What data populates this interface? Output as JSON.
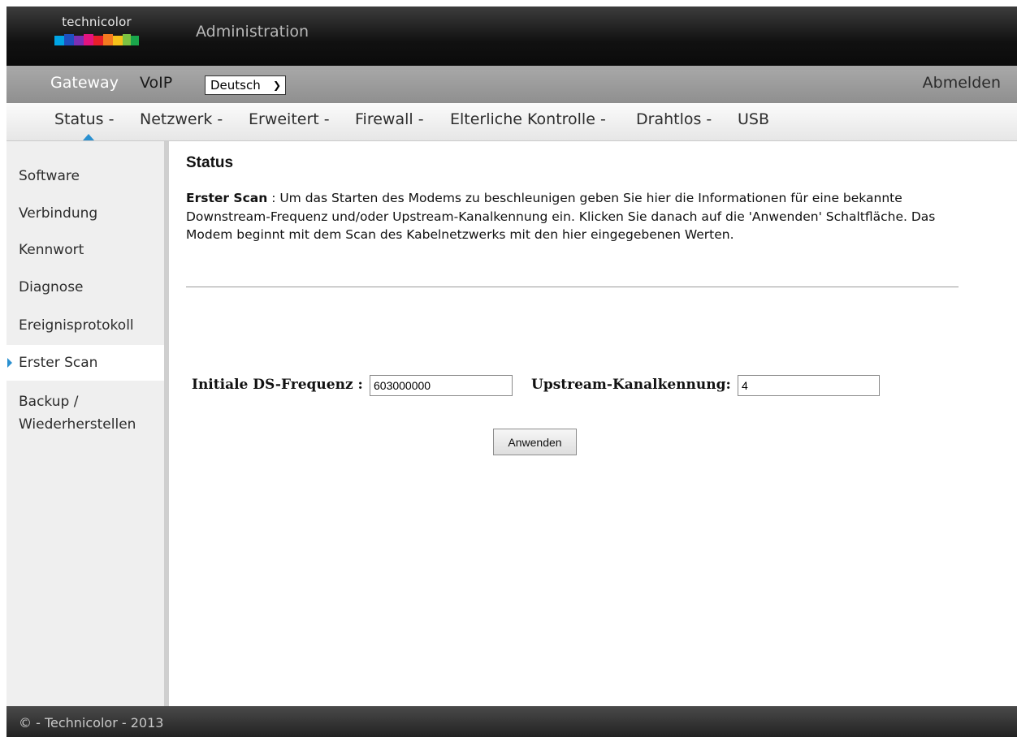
{
  "header": {
    "logo_text": "technicolor",
    "title": "Administration"
  },
  "nav_top": {
    "gateway": "Gateway",
    "voip": "VoIP",
    "language": "Deutsch",
    "logout": "Abmelden"
  },
  "nav_tabs": [
    {
      "label": "Status -",
      "active": true
    },
    {
      "label": "Netzwerk -"
    },
    {
      "label": "Erweitert -"
    },
    {
      "label": "Firewall -"
    },
    {
      "label": "Elterliche Kontrolle -"
    },
    {
      "label": "Drahtlos -"
    },
    {
      "label": "USB"
    }
  ],
  "sidebar": {
    "items": [
      {
        "label": "Software"
      },
      {
        "label": "Verbindung"
      },
      {
        "label": "Kennwort"
      },
      {
        "label": "Diagnose"
      },
      {
        "label": "Ereignisprotokoll"
      },
      {
        "label": "Erster Scan",
        "active": true
      },
      {
        "label": "Backup /"
      }
    ],
    "backup_line2": "Wiederherstellen"
  },
  "main": {
    "title": "Status",
    "desc_bold": "Erster Scan",
    "desc_text": " : Um das Starten des Modems zu beschleunigen geben Sie hier die Informationen für eine bekannte Downstream-Frequenz und/oder Upstream-Kanalkennung ein. Klicken Sie danach auf die 'Anwenden' Schaltfläche. Das Modem beginnt mit dem Scan des Kabelnetzwerks mit den hier eingegebenen Werten.",
    "ds_label": "Initiale DS-Frequenz :",
    "ds_value": "603000000",
    "us_label": "Upstream-Kanalkennung:",
    "us_value": "4",
    "apply_button": "Anwenden"
  },
  "footer": {
    "text": "© - Technicolor - 2013"
  },
  "colors": {
    "accent": "#2a90d0"
  }
}
